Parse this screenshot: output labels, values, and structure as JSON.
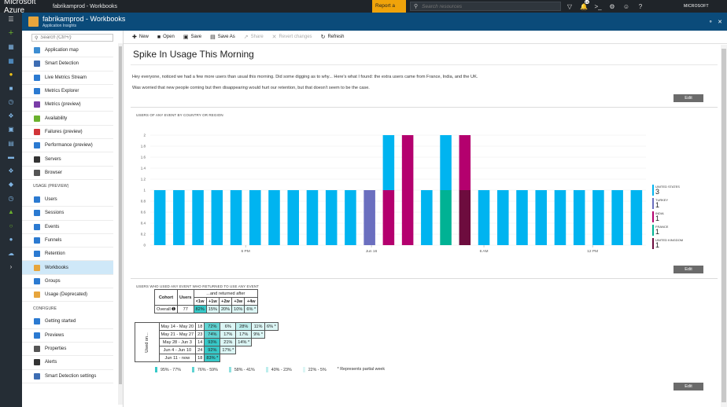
{
  "topbar": {
    "brand": "Microsoft Azure",
    "crumb": "fabrikamprod - Workbooks",
    "report_bug": "Report a bug",
    "search_placeholder": "Search resources",
    "notif_count": "10",
    "account": "MICROSOFT"
  },
  "blade": {
    "title": "fabrikamprod - Workbooks",
    "subtitle": "Application Insights"
  },
  "nav": {
    "search_placeholder": "Search (Ctrl+/)",
    "items_top": [
      {
        "label": "Application map",
        "color": "#3c8dd2"
      },
      {
        "label": "Smart Detection",
        "color": "#3d6db3"
      },
      {
        "label": "Live Metrics Stream",
        "color": "#2b7ad1"
      },
      {
        "label": "Metrics Explorer",
        "color": "#2b7ad1"
      },
      {
        "label": "Metrics (preview)",
        "color": "#7a3da8"
      },
      {
        "label": "Availability",
        "color": "#6bb12e"
      },
      {
        "label": "Failures (preview)",
        "color": "#d13438"
      },
      {
        "label": "Performance (preview)",
        "color": "#2b7ad1"
      },
      {
        "label": "Servers",
        "color": "#333333"
      },
      {
        "label": "Browser",
        "color": "#555555"
      }
    ],
    "usage_section": "USAGE (PREVIEW)",
    "items_usage": [
      {
        "label": "Users",
        "color": "#2b7ad1"
      },
      {
        "label": "Sessions",
        "color": "#2b7ad1"
      },
      {
        "label": "Events",
        "color": "#2b7ad1"
      },
      {
        "label": "Funnels",
        "color": "#2b7ad1"
      },
      {
        "label": "Retention",
        "color": "#2b7ad1"
      },
      {
        "label": "Workbooks",
        "color": "#e7a53c"
      },
      {
        "label": "Groups",
        "color": "#2b7ad1"
      },
      {
        "label": "Usage (Deprecated)",
        "color": "#e7a53c"
      }
    ],
    "configure_section": "CONFIGURE",
    "items_config": [
      {
        "label": "Getting started",
        "color": "#2b7ad1"
      },
      {
        "label": "Previews",
        "color": "#2b7ad1"
      },
      {
        "label": "Properties",
        "color": "#555555"
      },
      {
        "label": "Alerts",
        "color": "#333333"
      },
      {
        "label": "Smart Detection settings",
        "color": "#3d6db3"
      }
    ]
  },
  "toolbar": {
    "new": "New",
    "open": "Open",
    "save": "Save",
    "save_as": "Save As",
    "share": "Share",
    "revert": "Revert changes",
    "refresh": "Refresh"
  },
  "workbook": {
    "title": "Spike In Usage This Morning",
    "para1": "Hey everyone, noticed we had a few more users than usual this morning. Did some digging as to why... Here's what I found: the extra users came from France, India, and the UK.",
    "para2": "Was worried that new people coming but then disappearing would hurt our retention, but that doesn't seem to be the case.",
    "edit": "Edit"
  },
  "chart_data": {
    "type": "bar",
    "title": "USERS OF ANY EVENT BY COUNTRY OR REGION",
    "ylim": [
      0,
      2.2
    ],
    "yticks": [
      "0",
      "0.2",
      "0.4",
      "0.6",
      "0.8",
      "1",
      "1.2",
      "1.4",
      "1.6",
      "1.8",
      "2"
    ],
    "xtick_labels": [
      "6 PM",
      "Jun 16",
      "6 AM",
      "12 PM"
    ],
    "colors": {
      "United States": "#00b4f0",
      "Turkey": "#6b6fbf",
      "India": "#b4006e",
      "France": "#00b294",
      "United Kingdom": "#6d0c3e"
    },
    "bars": [
      [
        {
          "s": "United States",
          "v": 1
        }
      ],
      [
        {
          "s": "United States",
          "v": 1
        }
      ],
      [
        {
          "s": "United States",
          "v": 1
        }
      ],
      [
        {
          "s": "United States",
          "v": 1
        }
      ],
      [
        {
          "s": "United States",
          "v": 1
        }
      ],
      [
        {
          "s": "United States",
          "v": 1
        }
      ],
      [
        {
          "s": "United States",
          "v": 1
        }
      ],
      [
        {
          "s": "United States",
          "v": 1
        }
      ],
      [
        {
          "s": "United States",
          "v": 1
        }
      ],
      [
        {
          "s": "United States",
          "v": 1
        }
      ],
      [
        {
          "s": "United States",
          "v": 1
        }
      ],
      [
        {
          "s": "Turkey",
          "v": 1
        }
      ],
      [
        {
          "s": "India",
          "v": 1
        },
        {
          "s": "United States",
          "v": 1
        }
      ],
      [
        {
          "s": "India",
          "v": 2
        }
      ],
      [
        {
          "s": "United States",
          "v": 1
        }
      ],
      [
        {
          "s": "France",
          "v": 1
        },
        {
          "s": "United States",
          "v": 1
        }
      ],
      [
        {
          "s": "United Kingdom",
          "v": 1
        },
        {
          "s": "India",
          "v": 1
        }
      ],
      [
        {
          "s": "United States",
          "v": 1
        }
      ],
      [
        {
          "s": "United States",
          "v": 1
        }
      ],
      [
        {
          "s": "United States",
          "v": 1
        }
      ],
      [
        {
          "s": "United States",
          "v": 1
        }
      ],
      [
        {
          "s": "United States",
          "v": 1
        }
      ],
      [
        {
          "s": "United States",
          "v": 1
        }
      ],
      [
        {
          "s": "United States",
          "v": 1
        }
      ],
      [
        {
          "s": "United States",
          "v": 1
        }
      ],
      [
        {
          "s": "United States",
          "v": 1
        }
      ]
    ],
    "legend": [
      {
        "name": "UNITED STATES",
        "value": "3",
        "color": "#00b4f0"
      },
      {
        "name": "TURKEY",
        "value": "1",
        "color": "#6b6fbf"
      },
      {
        "name": "INDIA",
        "value": "1",
        "color": "#b4006e"
      },
      {
        "name": "FRANCE",
        "value": "1",
        "color": "#00b294"
      },
      {
        "name": "UNITED KINGDOM",
        "value": "1",
        "color": "#6d0c3e"
      }
    ]
  },
  "retention": {
    "title": "USERS WHO USED ANY EVENT WHO RETURNED TO USE ANY EVENT",
    "h_cohort": "Cohort",
    "h_users": "Users",
    "h_returned": "...and returned after",
    "periods": [
      "<1w",
      "+1w",
      "+2w",
      "+3w",
      "+4w"
    ],
    "overall": {
      "label": "Overall",
      "users": "77",
      "cells": [
        "82%",
        "15%",
        "20%",
        "10%",
        "6% *"
      ]
    },
    "side_label": "Used on...",
    "rows": [
      {
        "cohort": "May 14 - May 20",
        "users": "18",
        "cells": [
          "72%",
          "6%",
          "28%",
          "11%",
          "6% *"
        ]
      },
      {
        "cohort": "May 21 - May 27",
        "users": "23",
        "cells": [
          "74%",
          "17%",
          "17%",
          "9% *"
        ]
      },
      {
        "cohort": "May 28 - Jun 3",
        "users": "14",
        "cells": [
          "93%",
          "21%",
          "14% *"
        ]
      },
      {
        "cohort": "Jun 4 - Jun 10",
        "users": "24",
        "cells": [
          "92%",
          "17% *"
        ]
      },
      {
        "cohort": "Jun 11 - now",
        "users": "18",
        "cells": [
          "83% *"
        ]
      }
    ],
    "legend": [
      {
        "label": "95% - 77%",
        "color": "#37c9c8"
      },
      {
        "label": "76% - 59%",
        "color": "#5fd3d2"
      },
      {
        "label": "58% - 41%",
        "color": "#8fe0df"
      },
      {
        "label": "40% - 23%",
        "color": "#bdeeed"
      },
      {
        "label": "22% - 5%",
        "color": "#dcf6f5"
      }
    ],
    "partial_note": "* Represents partial week"
  }
}
